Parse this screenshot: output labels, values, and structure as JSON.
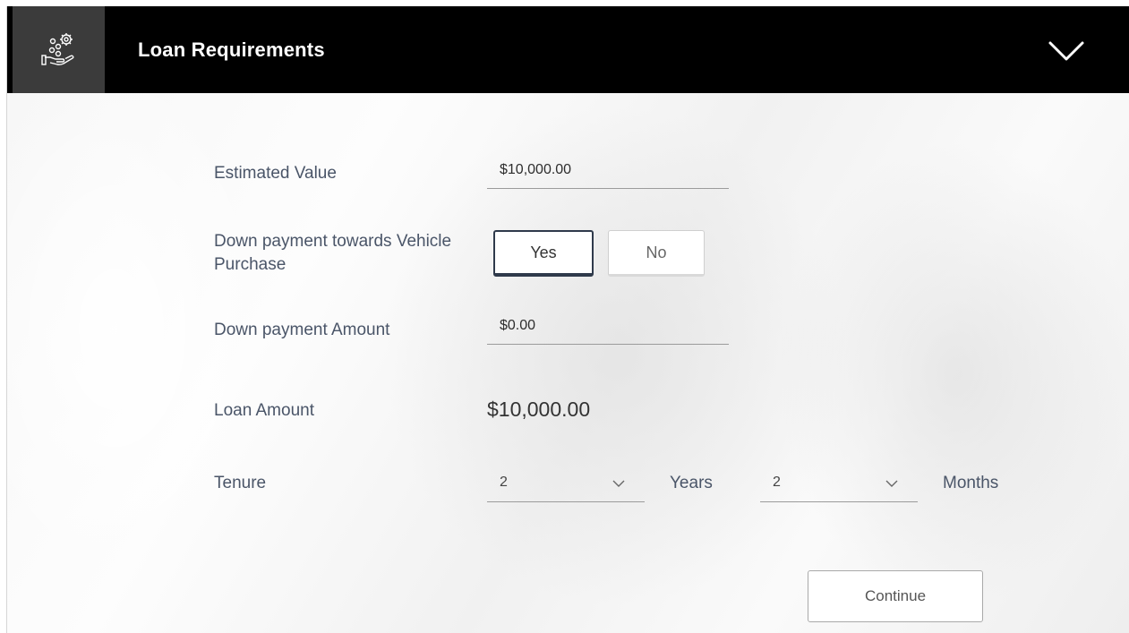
{
  "header": {
    "title": "Loan Requirements",
    "icon": "hand-coins-gear-icon",
    "collapse_icon": "chevron-down-icon"
  },
  "form": {
    "estimated_value": {
      "label": "Estimated Value",
      "value": "$10,000.00"
    },
    "down_payment_toggle": {
      "label": "Down payment towards Vehicle Purchase",
      "options": [
        "Yes",
        "No"
      ],
      "selected": "Yes"
    },
    "down_payment_amount": {
      "label": "Down payment Amount",
      "value": "$0.00"
    },
    "loan_amount": {
      "label": "Loan Amount",
      "value": "$10,000.00"
    },
    "tenure": {
      "label": "Tenure",
      "years_value": "2",
      "years_unit": "Years",
      "months_value": "2",
      "months_unit": "Months"
    },
    "continue_label": "Continue"
  },
  "colors": {
    "header_bg": "#000000",
    "header_icon_bg": "#3b3b3b",
    "label_text": "#4a5568",
    "selected_border": "#2f3a4b"
  }
}
